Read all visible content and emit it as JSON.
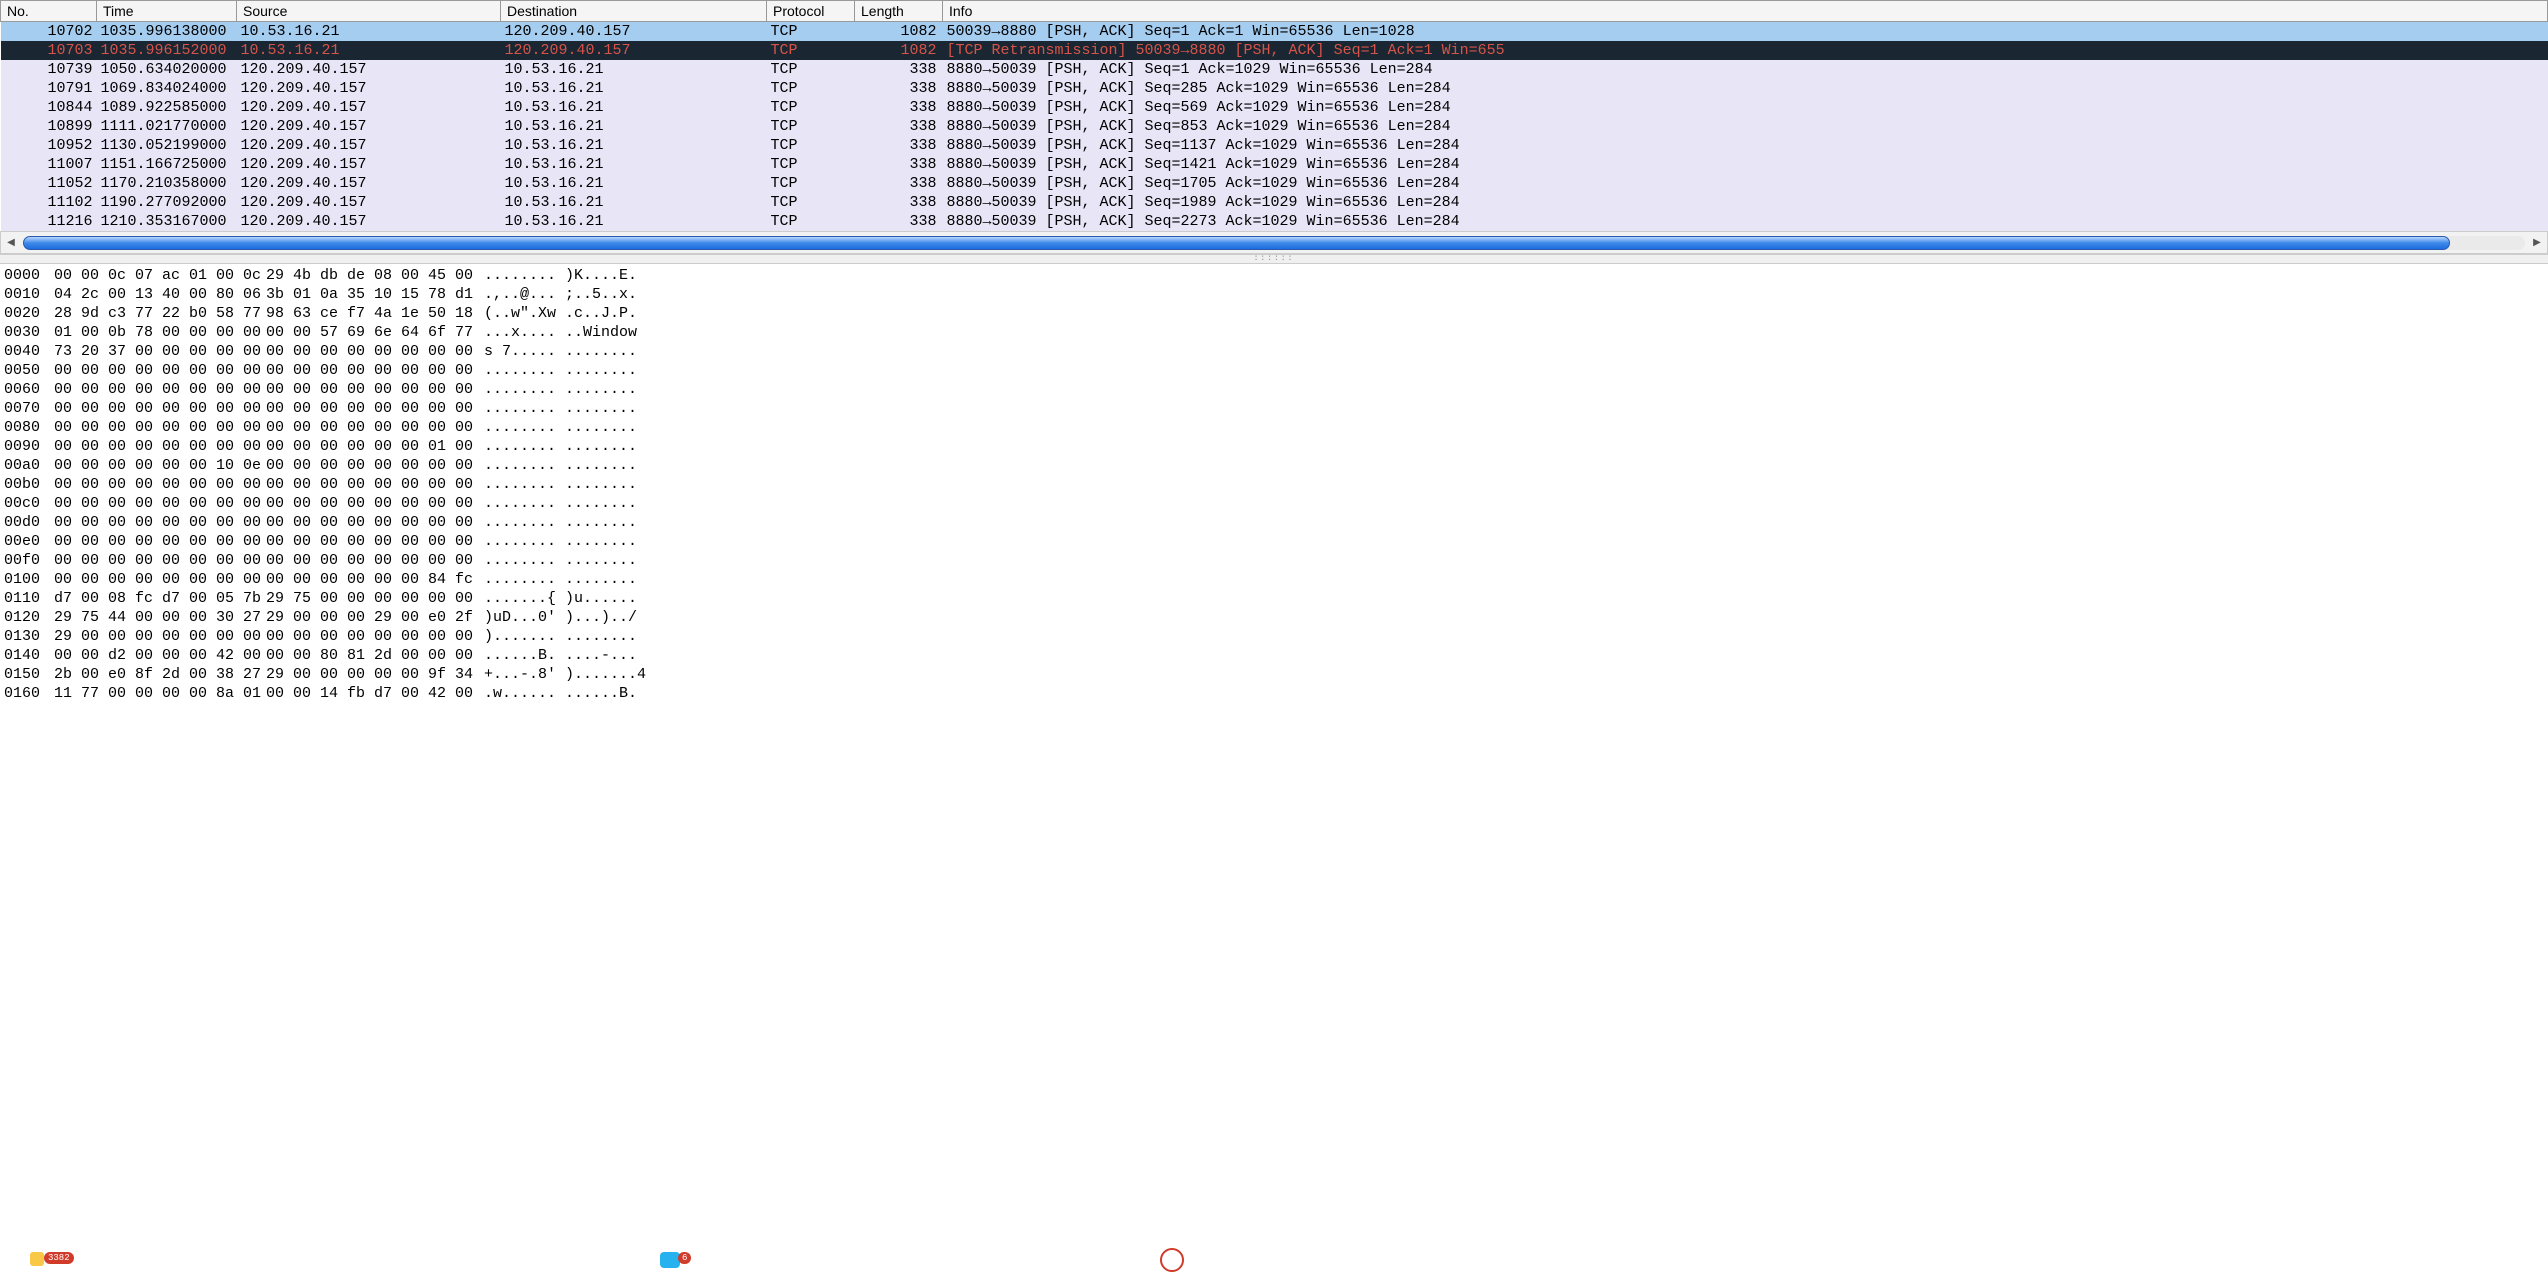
{
  "columns": {
    "no": "No.",
    "time": "Time",
    "source": "Source",
    "destination": "Destination",
    "protocol": "Protocol",
    "length": "Length",
    "info": "Info"
  },
  "rows": [
    {
      "no": "10702",
      "time": "1035.996138000",
      "source": "10.53.16.21",
      "destination": "120.209.40.157",
      "protocol": "TCP",
      "length": "1082",
      "info": "50039→8880 [PSH, ACK] Seq=1 Ack=1 Win=65536 Len=1028",
      "style": "row-selected"
    },
    {
      "no": "10703",
      "time": "1035.996152000",
      "source": "10.53.16.21",
      "destination": "120.209.40.157",
      "protocol": "TCP",
      "length": "1082",
      "info": "[TCP Retransmission] 50039→8880 [PSH, ACK] Seq=1 Ack=1 Win=655",
      "style": "row-dark"
    },
    {
      "no": "10739",
      "time": "1050.634020000",
      "source": "120.209.40.157",
      "destination": "10.53.16.21",
      "protocol": "TCP",
      "length": "338",
      "info": "8880→50039 [PSH, ACK] Seq=1 Ack=1029 Win=65536 Len=284",
      "style": "row-normal"
    },
    {
      "no": "10791",
      "time": "1069.834024000",
      "source": "120.209.40.157",
      "destination": "10.53.16.21",
      "protocol": "TCP",
      "length": "338",
      "info": "8880→50039 [PSH, ACK] Seq=285 Ack=1029 Win=65536 Len=284",
      "style": "row-normal"
    },
    {
      "no": "10844",
      "time": "1089.922585000",
      "source": "120.209.40.157",
      "destination": "10.53.16.21",
      "protocol": "TCP",
      "length": "338",
      "info": "8880→50039 [PSH, ACK] Seq=569 Ack=1029 Win=65536 Len=284",
      "style": "row-normal"
    },
    {
      "no": "10899",
      "time": "1111.021770000",
      "source": "120.209.40.157",
      "destination": "10.53.16.21",
      "protocol": "TCP",
      "length": "338",
      "info": "8880→50039 [PSH, ACK] Seq=853 Ack=1029 Win=65536 Len=284",
      "style": "row-normal"
    },
    {
      "no": "10952",
      "time": "1130.052199000",
      "source": "120.209.40.157",
      "destination": "10.53.16.21",
      "protocol": "TCP",
      "length": "338",
      "info": "8880→50039 [PSH, ACK] Seq=1137 Ack=1029 Win=65536 Len=284",
      "style": "row-normal"
    },
    {
      "no": "11007",
      "time": "1151.166725000",
      "source": "120.209.40.157",
      "destination": "10.53.16.21",
      "protocol": "TCP",
      "length": "338",
      "info": "8880→50039 [PSH, ACK] Seq=1421 Ack=1029 Win=65536 Len=284",
      "style": "row-normal"
    },
    {
      "no": "11052",
      "time": "1170.210358000",
      "source": "120.209.40.157",
      "destination": "10.53.16.21",
      "protocol": "TCP",
      "length": "338",
      "info": "8880→50039 [PSH, ACK] Seq=1705 Ack=1029 Win=65536 Len=284",
      "style": "row-normal"
    },
    {
      "no": "11102",
      "time": "1190.277092000",
      "source": "120.209.40.157",
      "destination": "10.53.16.21",
      "protocol": "TCP",
      "length": "338",
      "info": "8880→50039 [PSH, ACK] Seq=1989 Ack=1029 Win=65536 Len=284",
      "style": "row-normal"
    },
    {
      "no": "11216",
      "time": "1210.353167000",
      "source": "120.209.40.157",
      "destination": "10.53.16.21",
      "protocol": "TCP",
      "length": "338",
      "info": "8880→50039 [PSH, ACK] Seq=2273 Ack=1029 Win=65536 Len=284",
      "style": "row-normal"
    }
  ],
  "hex": [
    {
      "offset": "0000",
      "b1": "00 00 0c 07 ac 01 00 0c",
      "b2": "29 4b db de 08 00 45 00",
      "ascii": "........ )K....E."
    },
    {
      "offset": "0010",
      "b1": "04 2c 00 13 40 00 80 06",
      "b2": "3b 01 0a 35 10 15 78 d1",
      "ascii": ".,..@... ;..5..x."
    },
    {
      "offset": "0020",
      "b1": "28 9d c3 77 22 b0 58 77",
      "b2": "98 63 ce f7 4a 1e 50 18",
      "ascii": "(..w\".Xw .c..J.P."
    },
    {
      "offset": "0030",
      "b1": "01 00 0b 78 00 00 00 00",
      "b2": "00 00 57 69 6e 64 6f 77",
      "ascii": "...x.... ..Window"
    },
    {
      "offset": "0040",
      "b1": "73 20 37 00 00 00 00 00",
      "b2": "00 00 00 00 00 00 00 00",
      "ascii": "s 7..... ........"
    },
    {
      "offset": "0050",
      "b1": "00 00 00 00 00 00 00 00",
      "b2": "00 00 00 00 00 00 00 00",
      "ascii": "........ ........"
    },
    {
      "offset": "0060",
      "b1": "00 00 00 00 00 00 00 00",
      "b2": "00 00 00 00 00 00 00 00",
      "ascii": "........ ........"
    },
    {
      "offset": "0070",
      "b1": "00 00 00 00 00 00 00 00",
      "b2": "00 00 00 00 00 00 00 00",
      "ascii": "........ ........"
    },
    {
      "offset": "0080",
      "b1": "00 00 00 00 00 00 00 00",
      "b2": "00 00 00 00 00 00 00 00",
      "ascii": "........ ........"
    },
    {
      "offset": "0090",
      "b1": "00 00 00 00 00 00 00 00",
      "b2": "00 00 00 00 00 00 01 00",
      "ascii": "........ ........"
    },
    {
      "offset": "00a0",
      "b1": "00 00 00 00 00 00 10 0e",
      "b2": "00 00 00 00 00 00 00 00",
      "ascii": "........ ........"
    },
    {
      "offset": "00b0",
      "b1": "00 00 00 00 00 00 00 00",
      "b2": "00 00 00 00 00 00 00 00",
      "ascii": "........ ........"
    },
    {
      "offset": "00c0",
      "b1": "00 00 00 00 00 00 00 00",
      "b2": "00 00 00 00 00 00 00 00",
      "ascii": "........ ........"
    },
    {
      "offset": "00d0",
      "b1": "00 00 00 00 00 00 00 00",
      "b2": "00 00 00 00 00 00 00 00",
      "ascii": "........ ........"
    },
    {
      "offset": "00e0",
      "b1": "00 00 00 00 00 00 00 00",
      "b2": "00 00 00 00 00 00 00 00",
      "ascii": "........ ........"
    },
    {
      "offset": "00f0",
      "b1": "00 00 00 00 00 00 00 00",
      "b2": "00 00 00 00 00 00 00 00",
      "ascii": "........ ........"
    },
    {
      "offset": "0100",
      "b1": "00 00 00 00 00 00 00 00",
      "b2": "00 00 00 00 00 00 84 fc",
      "ascii": "........ ........"
    },
    {
      "offset": "0110",
      "b1": "d7 00 08 fc d7 00 05 7b",
      "b2": "29 75 00 00 00 00 00 00",
      "ascii": ".......{ )u......"
    },
    {
      "offset": "0120",
      "b1": "29 75 44 00 00 00 30 27",
      "b2": "29 00 00 00 29 00 e0 2f",
      "ascii": ")uD...0' )...)../"
    },
    {
      "offset": "0130",
      "b1": "29 00 00 00 00 00 00 00",
      "b2": "00 00 00 00 00 00 00 00",
      "ascii": ")....... ........"
    },
    {
      "offset": "0140",
      "b1": "00 00 d2 00 00 00 42 00",
      "b2": "00 00 80 81 2d 00 00 00",
      "ascii": "......B. ....-..."
    },
    {
      "offset": "0150",
      "b1": "2b 00 e0 8f 2d 00 38 27",
      "b2": "29 00 00 00 00 00 9f 34",
      "ascii": "+...-.8' ).......4"
    },
    {
      "offset": "0160",
      "b1": "11 77 00 00 00 00 8a 01",
      "b2": "00 00 14 fb d7 00 42 00",
      "ascii": ".w...... ......B."
    }
  ],
  "badges": {
    "b1": "3382",
    "b2": "6"
  }
}
